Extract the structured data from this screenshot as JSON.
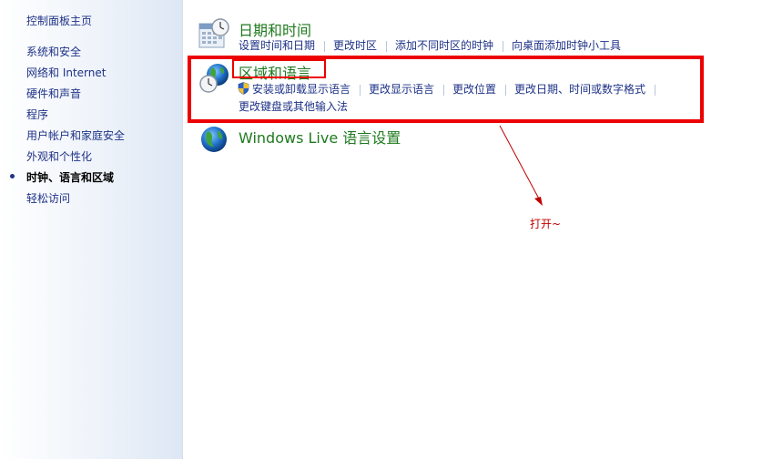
{
  "sidebar": {
    "home": "控制面板主页",
    "items": [
      {
        "label": "系统和安全"
      },
      {
        "label": "网络和 Internet"
      },
      {
        "label": "硬件和声音"
      },
      {
        "label": "程序"
      },
      {
        "label": "用户帐户和家庭安全"
      },
      {
        "label": "外观和个性化"
      },
      {
        "label": "时钟、语言和区域",
        "active": true
      },
      {
        "label": "轻松访问"
      }
    ]
  },
  "categories": {
    "datetime": {
      "title": "日期和时间",
      "icon": "calendar-clock-icon",
      "tasks": [
        "设置时间和日期",
        "更改时区",
        "添加不同时区的时钟",
        "向桌面添加时钟小工具"
      ]
    },
    "region": {
      "title": "区域和语言",
      "icon": "globe-clock-icon",
      "tasks": [
        "安装或卸载显示语言",
        "更改显示语言",
        "更改位置",
        "更改日期、时间或数字格式",
        "更改键盘或其他输入法"
      ]
    },
    "windows_live": {
      "title": "Windows Live 语言设置",
      "icon": "globe-icon"
    }
  },
  "annotation": {
    "text": "打开~",
    "color": "#c00000",
    "highlight_color": "#ec0000"
  },
  "colors": {
    "link": "#1e3287",
    "category_title": "#1f7a1f"
  }
}
